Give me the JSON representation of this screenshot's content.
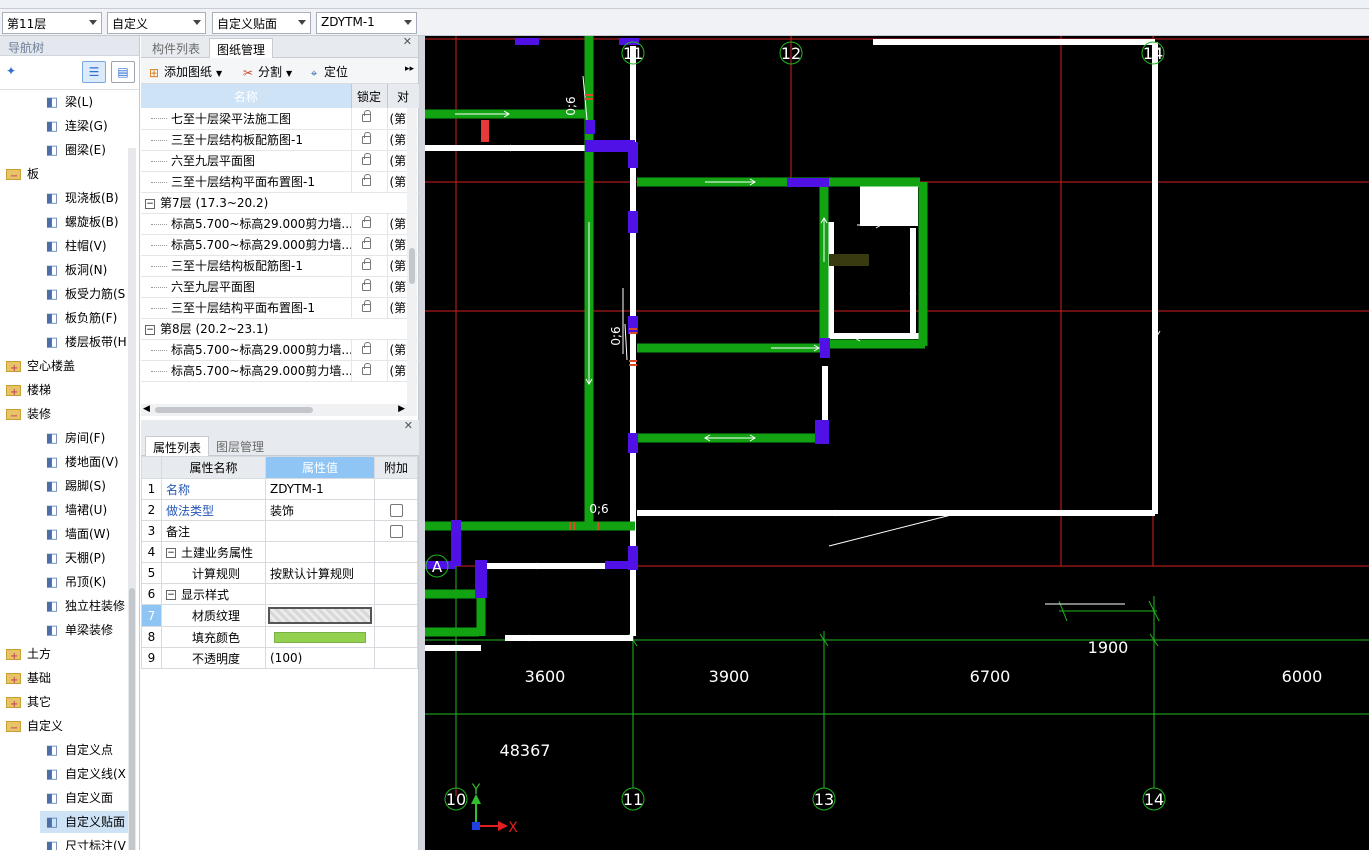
{
  "toolbar": {
    "floor": "第11层",
    "category": "自定义",
    "type": "自定义贴面",
    "component": "ZDYTM-1"
  },
  "nav": {
    "title": "导航树",
    "items": [
      {
        "label": "梁(L)",
        "icon": "beam-icon",
        "kind": "child"
      },
      {
        "label": "连梁(G)",
        "icon": "link-beam-icon",
        "kind": "child"
      },
      {
        "label": "圈梁(E)",
        "icon": "ring-beam-icon",
        "kind": "child"
      },
      {
        "label": "板",
        "icon": "folder-icon",
        "kind": "folder-open"
      },
      {
        "label": "现浇板(B)",
        "icon": "slab-icon",
        "kind": "child"
      },
      {
        "label": "螺旋板(B)",
        "icon": "spiral-slab-icon",
        "kind": "child"
      },
      {
        "label": "柱帽(V)",
        "icon": "column-cap-icon",
        "kind": "child"
      },
      {
        "label": "板洞(N)",
        "icon": "slab-hole-icon",
        "kind": "child"
      },
      {
        "label": "板受力筋(S",
        "icon": "slab-rebar-icon",
        "kind": "child"
      },
      {
        "label": "板负筋(F)",
        "icon": "neg-rebar-icon",
        "kind": "child"
      },
      {
        "label": "楼层板带(H",
        "icon": "slab-strip-icon",
        "kind": "child"
      },
      {
        "label": "空心楼盖",
        "icon": "folder-icon",
        "kind": "folder"
      },
      {
        "label": "楼梯",
        "icon": "folder-icon",
        "kind": "folder"
      },
      {
        "label": "装修",
        "icon": "folder-icon",
        "kind": "folder-open"
      },
      {
        "label": "房间(F)",
        "icon": "room-icon",
        "kind": "child"
      },
      {
        "label": "楼地面(V)",
        "icon": "floor-icon",
        "kind": "child"
      },
      {
        "label": "踢脚(S)",
        "icon": "skirting-icon",
        "kind": "child"
      },
      {
        "label": "墙裙(U)",
        "icon": "dado-icon",
        "kind": "child"
      },
      {
        "label": "墙面(W)",
        "icon": "wall-face-icon",
        "kind": "child"
      },
      {
        "label": "天棚(P)",
        "icon": "ceiling-icon",
        "kind": "child"
      },
      {
        "label": "吊顶(K)",
        "icon": "suspended-ceiling-icon",
        "kind": "child"
      },
      {
        "label": "独立柱装修",
        "icon": "column-finish-icon",
        "kind": "child"
      },
      {
        "label": "单梁装修",
        "icon": "beam-finish-icon",
        "kind": "child"
      },
      {
        "label": "土方",
        "icon": "folder-icon",
        "kind": "folder"
      },
      {
        "label": "基础",
        "icon": "folder-icon",
        "kind": "folder"
      },
      {
        "label": "其它",
        "icon": "folder-icon",
        "kind": "folder"
      },
      {
        "label": "自定义",
        "icon": "folder-icon",
        "kind": "folder-open"
      },
      {
        "label": "自定义点",
        "icon": "custom-point-icon",
        "kind": "child"
      },
      {
        "label": "自定义线(X",
        "icon": "custom-line-icon",
        "kind": "child"
      },
      {
        "label": "自定义面",
        "icon": "custom-face-icon",
        "kind": "child"
      },
      {
        "label": "自定义贴面",
        "icon": "custom-veneer-icon",
        "kind": "child-selected"
      },
      {
        "label": "尺寸标注(V",
        "icon": "dimension-icon",
        "kind": "child"
      }
    ]
  },
  "drawings": {
    "tab_components": "构件列表",
    "tab_drawings": "图纸管理",
    "add_label": "添加图纸",
    "split_label": "分割",
    "locate_label": "定位",
    "col_name": "名称",
    "col_lock": "锁定",
    "col_extra": "对",
    "rows": [
      {
        "name": "七至十层梁平法施工图",
        "group": false,
        "extra": "(第"
      },
      {
        "name": "三至十层结构板配筋图-1",
        "group": false,
        "extra": "(第"
      },
      {
        "name": "六至九层平面图",
        "group": false,
        "extra": "(第"
      },
      {
        "name": "三至十层结构平面布置图-1",
        "group": false,
        "extra": "(第"
      },
      {
        "name": "第7层 (17.3~20.2)",
        "group": true,
        "extra": ""
      },
      {
        "name": "标高5.700~标高29.000剪力墙...",
        "group": false,
        "extra": "(第"
      },
      {
        "name": "标高5.700~标高29.000剪力墙...",
        "group": false,
        "extra": "(第"
      },
      {
        "name": "三至十层结构板配筋图-1",
        "group": false,
        "extra": "(第"
      },
      {
        "name": "六至九层平面图",
        "group": false,
        "extra": "(第"
      },
      {
        "name": "三至十层结构平面布置图-1",
        "group": false,
        "extra": "(第"
      },
      {
        "name": "第8层 (20.2~23.1)",
        "group": true,
        "extra": ""
      },
      {
        "name": "标高5.700~标高29.000剪力墙...",
        "group": false,
        "extra": "(第"
      },
      {
        "name": "标高5.700~标高29.000剪力墙...",
        "group": false,
        "extra": "(第"
      }
    ]
  },
  "props": {
    "tab_props": "属性列表",
    "tab_layers": "图层管理",
    "col_name": "属性名称",
    "col_value": "属性值",
    "col_extra": "附加",
    "rows": [
      {
        "num": "1",
        "name": "名称",
        "value": "ZDYTM-1",
        "link": true,
        "check": false,
        "indent": 0
      },
      {
        "num": "2",
        "name": "做法类型",
        "value": "装饰",
        "link": true,
        "check": true,
        "indent": 0
      },
      {
        "num": "3",
        "name": "备注",
        "value": "",
        "link": false,
        "check": true,
        "indent": 0
      },
      {
        "num": "4",
        "name": "土建业务属性",
        "value": "",
        "link": false,
        "check": false,
        "indent": 0,
        "group": true
      },
      {
        "num": "5",
        "name": "计算规则",
        "value": "按默认计算规则",
        "link": false,
        "check": false,
        "indent": 1
      },
      {
        "num": "6",
        "name": "显示样式",
        "value": "",
        "link": false,
        "check": false,
        "indent": 0,
        "group": true
      },
      {
        "num": "7",
        "name": "材质纹理",
        "value": "",
        "link": false,
        "check": false,
        "indent": 1,
        "texture": true
      },
      {
        "num": "8",
        "name": "填充颜色",
        "value": "",
        "link": false,
        "check": false,
        "indent": 1,
        "color": "#92d050"
      },
      {
        "num": "9",
        "name": "不透明度",
        "value": "(100)",
        "link": false,
        "check": false,
        "indent": 1
      }
    ]
  },
  "canvas": {
    "axes_top": [
      "11",
      "12",
      "14"
    ],
    "axes_bottom": [
      "10",
      "11",
      "13",
      "14"
    ],
    "axis_a": "A",
    "dims": [
      "3600",
      "3900",
      "6700",
      "6000",
      "1900"
    ],
    "total": "48367",
    "marks": [
      "0;6",
      "0;6",
      "0;6"
    ],
    "ucs_y": "Y",
    "ucs_x": "X"
  }
}
